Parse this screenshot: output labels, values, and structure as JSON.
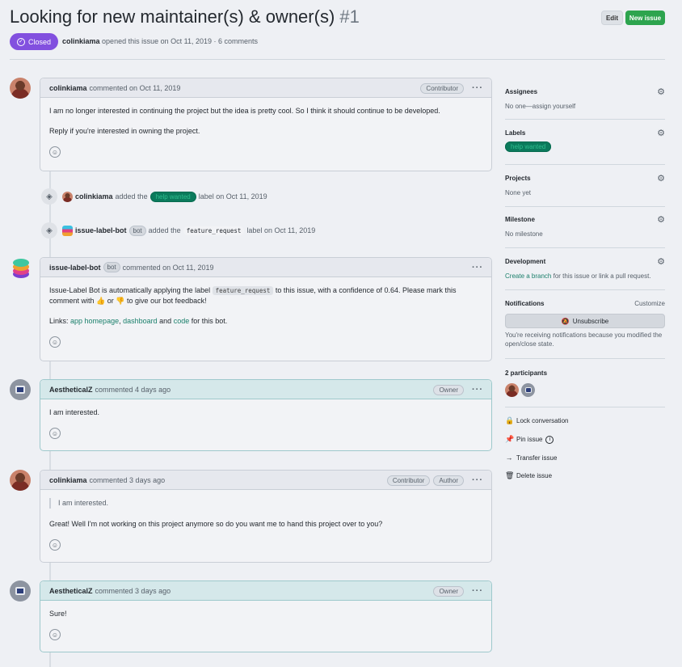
{
  "header": {
    "title": "Looking for new maintainer(s) & owner(s)",
    "number": "#1",
    "edit_label": "Edit",
    "new_issue_label": "New issue",
    "state": "Closed",
    "author": "colinkiama",
    "meta_text": "opened this issue on Oct 11, 2019 · 6 comments"
  },
  "comments": [
    {
      "author": "colinkiama",
      "action": "commented on Oct 11, 2019",
      "badges": [
        "Contributor"
      ],
      "paragraphs": [
        "I am no longer interested in continuing the project but the idea is pretty cool. So I think it should continue to be developed.",
        "Reply if you're interested in owning the project."
      ]
    },
    {
      "author": "issue-label-bot",
      "bot_badge": "bot",
      "action": "commented on Oct 11, 2019",
      "text_before": "Issue-Label Bot is automatically applying the label",
      "code": "feature_request",
      "text_after": "to this issue, with a confidence of 0.64. Please mark this comment with",
      "thumbs_up": "👍",
      "or": "or",
      "thumbs_down": "👎",
      "text_end": "to give our bot feedback!",
      "links_prefix": "Links:",
      "link1": "app homepage",
      "link2": "dashboard",
      "and": "and",
      "link3": "code",
      "links_suffix": "for this bot."
    },
    {
      "author": "AestheticalZ",
      "action": "commented 4 days ago",
      "badges": [
        "Owner"
      ],
      "paragraphs": [
        "I am interested."
      ]
    },
    {
      "author": "colinkiama",
      "action": "commented 3 days ago",
      "badges": [
        "Contributor",
        "Author"
      ],
      "quote": "I am interested.",
      "paragraphs": [
        "Great! Well I'm not working on this project anymore so do you want me to hand this project over to you?"
      ]
    },
    {
      "author": "AestheticalZ",
      "action": "commented 3 days ago",
      "badges": [
        "Owner"
      ],
      "paragraphs": [
        "Sure!"
      ]
    }
  ],
  "events": [
    {
      "actor": "colinkiama",
      "pre": "added the",
      "label": "help wanted",
      "post": "label on Oct 11, 2019"
    },
    {
      "actor": "issue-label-bot",
      "bot_badge": "bot",
      "pre": "added the",
      "label": "feature_request",
      "post": "label on Oct 11, 2019"
    }
  ],
  "sidebar": {
    "assignees_title": "Assignees",
    "assignees_value": "No one—assign yourself",
    "labels_title": "Labels",
    "label_help": "help wanted",
    "projects_title": "Projects",
    "projects_value": "None yet",
    "milestone_title": "Milestone",
    "milestone_value": "No milestone",
    "development_title": "Development",
    "development_link": "Create a branch",
    "development_rest": "for this issue or link a pull request.",
    "notifications_title": "Notifications",
    "customize": "Customize",
    "unsubscribe": "Unsubscribe",
    "notif_reason": "You're receiving notifications because you modified the open/close state.",
    "participants": "2 participants",
    "lock": "Lock conversation",
    "pin": "Pin issue",
    "transfer": "Transfer issue",
    "delete": "Delete issue"
  },
  "colors": {
    "closed_badge": "#8250df",
    "new_issue": "#2da44e",
    "label_help_wanted": "#0b7a5c",
    "link": "#1a7f6b"
  }
}
